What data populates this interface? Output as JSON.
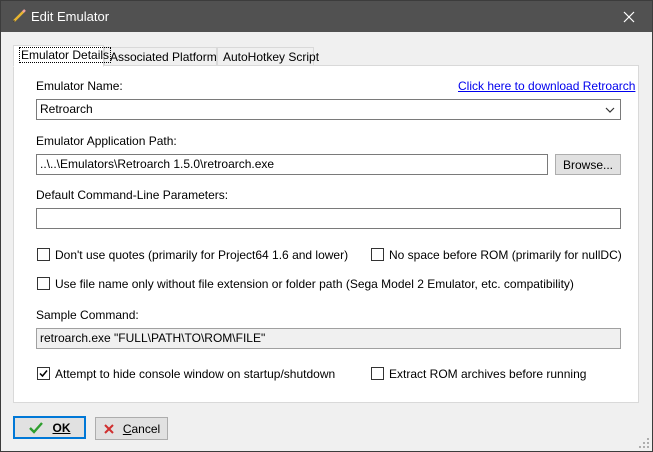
{
  "window": {
    "title": "Edit Emulator"
  },
  "tabs": [
    {
      "label": "Emulator Details"
    },
    {
      "label": "Associated Platforms"
    },
    {
      "label": "AutoHotkey Script"
    }
  ],
  "form": {
    "name_label": "Emulator Name:",
    "download_link": "Click here to download Retroarch",
    "name_value": "Retroarch",
    "path_label": "Emulator Application Path:",
    "path_value": "..\\..\\Emulators\\Retroarch 1.5.0\\retroarch.exe",
    "browse_label": "Browse...",
    "params_label": "Default Command-Line Parameters:",
    "params_value": "",
    "no_quotes_label": "Don't use quotes (primarily for Project64 1.6 and lower)",
    "no_quotes_checked": false,
    "no_space_label": "No space before ROM (primarily for nullDC)",
    "no_space_checked": false,
    "filename_only_label": "Use file name only without file extension or folder path (Sega Model 2 Emulator, etc. compatibility)",
    "filename_only_checked": false,
    "sample_label": "Sample Command:",
    "sample_value": "retroarch.exe \"FULL\\PATH\\TO\\ROM\\FILE\"",
    "hide_console_label": "Attempt to hide console window on startup/shutdown",
    "hide_console_checked": true,
    "extract_label": "Extract ROM archives before running",
    "extract_checked": false
  },
  "buttons": {
    "ok_label": "OK",
    "cancel_label": "Cancel"
  },
  "icons": {
    "title": "pencil-icon",
    "close": "close-icon",
    "dropdown": "chevron-down-icon",
    "ok": "checkmark-icon",
    "cancel": "x-icon"
  },
  "colors": {
    "titlebar": "#515151",
    "link": "#0000ee",
    "ok_icon": "#2e9e2e",
    "cancel_icon": "#d03030",
    "default_button_border": "#0078d7"
  }
}
